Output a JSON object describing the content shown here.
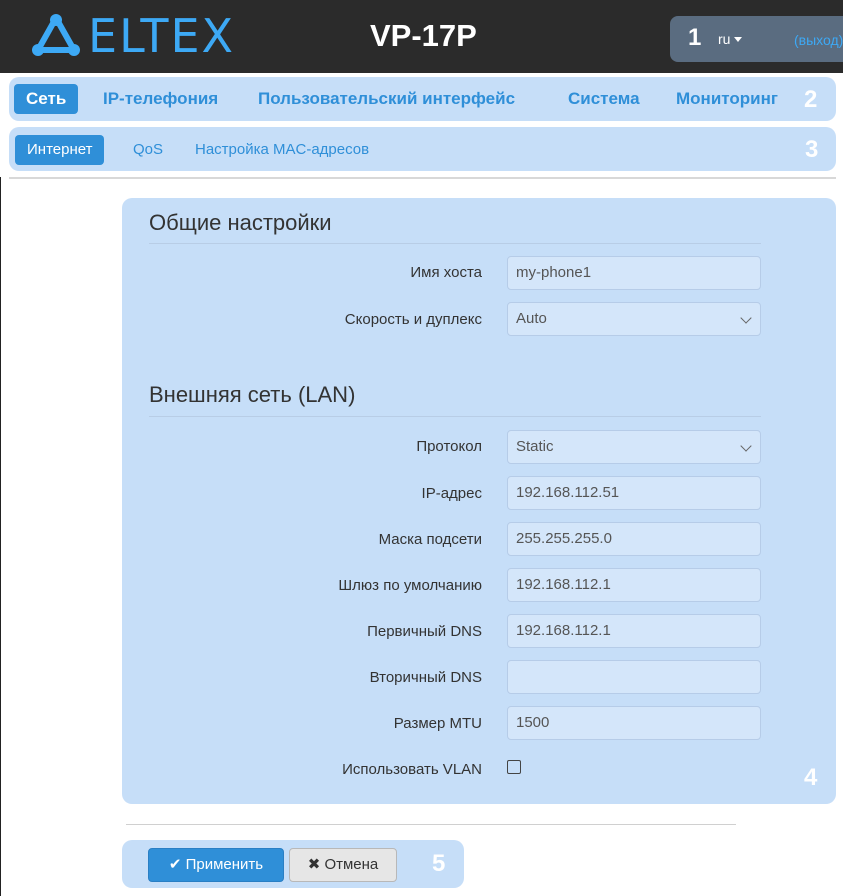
{
  "header": {
    "logo_text": "ELTEX",
    "model": "VP-17P",
    "callout": "1",
    "language": "ru",
    "logout_label": "(выход)"
  },
  "main_nav": {
    "callout": "2",
    "tabs": [
      {
        "label": "Сеть",
        "active": true
      },
      {
        "label": "IP-телефония",
        "active": false
      },
      {
        "label": "Пользовательский интерфейс",
        "active": false
      },
      {
        "label": "Система",
        "active": false
      },
      {
        "label": "Мониторинг",
        "active": false
      }
    ]
  },
  "sub_nav": {
    "callout": "3",
    "tabs": [
      {
        "label": "Интернет",
        "active": true
      },
      {
        "label": "QoS",
        "active": false
      },
      {
        "label": "Настройка MAC-адресов",
        "active": false
      }
    ]
  },
  "settings": {
    "callout": "4",
    "general_title": "Общие настройки",
    "hostname_label": "Имя хоста",
    "hostname_value": "my-phone1",
    "speed_label": "Скорость и дуплекс",
    "speed_value": "Auto",
    "lan_title": "Внешняя сеть (LAN)",
    "protocol_label": "Протокол",
    "protocol_value": "Static",
    "ip_label": "IP-адрес",
    "ip_value": "192.168.112.51",
    "mask_label": "Маска подсети",
    "mask_value": "255.255.255.0",
    "gateway_label": "Шлюз по умолчанию",
    "gateway_value": "192.168.112.1",
    "dns1_label": "Первичный DNS",
    "dns1_value": "192.168.112.1",
    "dns2_label": "Вторичный DNS",
    "dns2_value": "",
    "mtu_label": "Размер MTU",
    "mtu_value": "1500",
    "vlan_label": "Использовать VLAN",
    "vlan_checked": false
  },
  "actions": {
    "callout": "5",
    "apply_label": "Применить",
    "cancel_label": "Отмена"
  },
  "colors": {
    "accent": "#2f8fd8",
    "band": "#c6def8",
    "header_bg": "#2b2b2b"
  }
}
